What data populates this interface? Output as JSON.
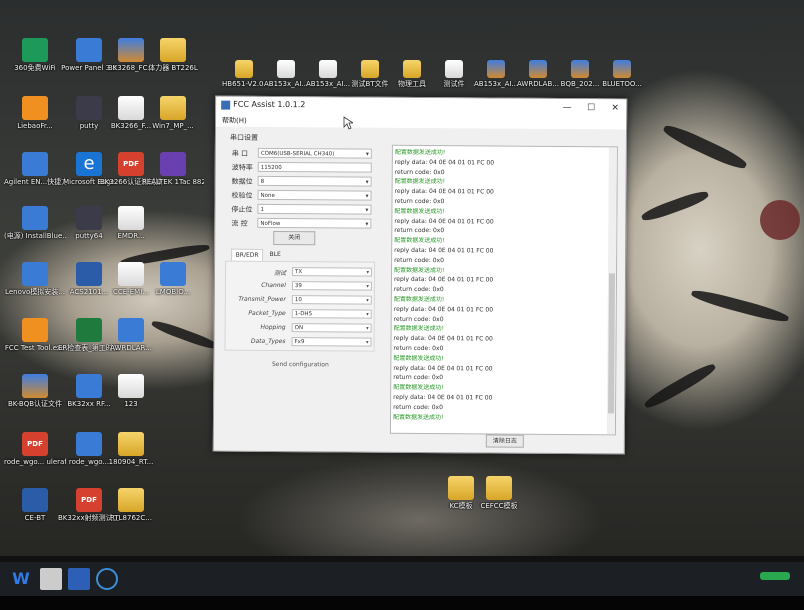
{
  "window": {
    "title": "FCC Assist 1.0.1.2",
    "menu_help": "帮助(H)",
    "minimize": "—",
    "maximize": "☐",
    "close": "✕"
  },
  "serial": {
    "title": "串口设置",
    "rows": [
      {
        "label": "串 口",
        "value": "COM6(USB-SERIAL CH340)"
      },
      {
        "label": "波特率",
        "value": "115200"
      },
      {
        "label": "数据位",
        "value": "8"
      },
      {
        "label": "校验位",
        "value": "None"
      },
      {
        "label": "停止位",
        "value": "1"
      },
      {
        "label": "流 控",
        "value": "NoFlow"
      }
    ],
    "open_button": "关闭"
  },
  "tabs": [
    "BR/EDR",
    "BLE"
  ],
  "config": [
    {
      "label": "测试",
      "value": "TX"
    },
    {
      "label": "Channel",
      "value": "39"
    },
    {
      "label": "Transmit_Power",
      "value": "10"
    },
    {
      "label": "Packet_Type",
      "value": "1-DH5"
    },
    {
      "label": "Hopping",
      "value": "ON"
    },
    {
      "label": "Data_Types",
      "value": "Fx9"
    }
  ],
  "send_button": "Send configuration",
  "log_lines": [
    {
      "text": "配置数据发送成功!",
      "ok": true
    },
    {
      "text": "reply data: 04 0E 04 01 01 FC 00",
      "ok": false
    },
    {
      "text": "return code: 0x0",
      "ok": false
    },
    {
      "text": "配置数据发送成功!",
      "ok": true
    },
    {
      "text": "reply data: 04 0E 04 01 01 FC 00",
      "ok": false
    },
    {
      "text": "return code: 0x0",
      "ok": false
    },
    {
      "text": "配置数据发送成功!",
      "ok": true
    },
    {
      "text": "reply data: 04 0E 04 01 01 FC 00",
      "ok": false
    },
    {
      "text": "return code: 0x0",
      "ok": false
    },
    {
      "text": "配置数据发送成功!",
      "ok": true
    },
    {
      "text": "reply data: 04 0E 04 01 01 FC 00",
      "ok": false
    },
    {
      "text": "return code: 0x0",
      "ok": false
    },
    {
      "text": "配置数据发送成功!",
      "ok": true
    },
    {
      "text": "reply data: 04 0E 04 01 01 FC 00",
      "ok": false
    },
    {
      "text": "return code: 0x0",
      "ok": false
    },
    {
      "text": "配置数据发送成功!",
      "ok": true
    },
    {
      "text": "reply data: 04 0E 04 01 01 FC 00",
      "ok": false
    },
    {
      "text": "return code: 0x0",
      "ok": false
    },
    {
      "text": "配置数据发送成功!",
      "ok": true
    },
    {
      "text": "reply data: 04 0E 04 01 01 FC 00",
      "ok": false
    },
    {
      "text": "return code: 0x0",
      "ok": false
    },
    {
      "text": "配置数据发送成功!",
      "ok": true
    },
    {
      "text": "reply data: 04 0E 04 01 01 FC 00",
      "ok": false
    },
    {
      "text": "return code: 0x0",
      "ok": false
    },
    {
      "text": "配置数据发送成功!",
      "ok": true
    },
    {
      "text": "reply data: 04 0E 04 01 01 FC 00",
      "ok": false
    },
    {
      "text": "return code: 0x0",
      "ok": false
    },
    {
      "text": "配置数据发送成功!",
      "ok": true
    }
  ],
  "clear_button": "清除日志",
  "desktop_icons": [
    {
      "label": "360免费WiFi",
      "icon": "wifi-icon"
    },
    {
      "label": "Power Panel 3.9",
      "icon": "app-icon"
    },
    {
      "label": "BK3268_FC...",
      "icon": "stack-icon"
    },
    {
      "label": "体力器 BT226L",
      "icon": "folder-icon"
    },
    {
      "label": "LiebaoFr...",
      "icon": "orange-icon"
    },
    {
      "label": "putty",
      "icon": "putty-icon"
    },
    {
      "label": "BK3266_F...",
      "icon": "file-icon"
    },
    {
      "label": "Win7_MP_...",
      "icon": "folder-icon"
    },
    {
      "label": "Agilent EN...快捷方式",
      "icon": "app-icon"
    },
    {
      "label": "Microsoft Edge",
      "icon": "edge-icon"
    },
    {
      "label": "BK3266认证测试操作...",
      "icon": "pdf-icon"
    },
    {
      "label": "REALTEK 1Tac 8821...",
      "icon": "purple-icon"
    },
    {
      "label": "(电源) InstallBlue...",
      "icon": "app-icon"
    },
    {
      "label": "putty64",
      "icon": "putty-icon"
    },
    {
      "label": "EMDR...",
      "icon": "file-icon"
    },
    {
      "label": "Lenovo模拟安装...",
      "icon": "app-icon"
    },
    {
      "label": "ACS2101...",
      "icon": "word-icon"
    },
    {
      "label": "CCE-EMI...",
      "icon": "file-icon"
    },
    {
      "label": "LMOBIO...",
      "icon": "app-icon"
    },
    {
      "label": "FCC Test Tool.exe",
      "icon": "orange-icon"
    },
    {
      "label": "ER检查表_第工时(20...",
      "icon": "excel-icon"
    },
    {
      "label": "AWRDLAR...",
      "icon": "app-icon"
    },
    {
      "label": "BK-BQB认证文件",
      "icon": "stack-icon"
    },
    {
      "label": "BK32xx RF...",
      "icon": "app-icon"
    },
    {
      "label": "123",
      "icon": "file-icon"
    },
    {
      "label": "rode_wgo... ulerafe...",
      "icon": "pdf-icon"
    },
    {
      "label": "rode_wgo...",
      "icon": "app-icon"
    },
    {
      "label": "180904_RT...",
      "icon": "folder-icon"
    },
    {
      "label": "CE-BT",
      "icon": "word-icon"
    },
    {
      "label": "BK32xx射频测试工具应...",
      "icon": "pdf-icon"
    },
    {
      "label": "RTL8762C...",
      "icon": "folder-icon"
    },
    {
      "label": "KC模板",
      "icon": "folder-icon"
    },
    {
      "label": "CEFCC模板",
      "icon": "folder-icon"
    }
  ],
  "top_icons": [
    {
      "label": "HB651-V2.0 测试工具",
      "icon": "folder-icon"
    },
    {
      "label": "AB153x_AI...",
      "icon": "file-icon"
    },
    {
      "label": "AB153x_AI...",
      "icon": "file-icon"
    },
    {
      "label": "测试BT文件",
      "icon": "folder-icon"
    },
    {
      "label": "物理工具",
      "icon": "folder-icon"
    },
    {
      "label": "测试件",
      "icon": "file-icon"
    },
    {
      "label": "AB153x_AI...",
      "icon": "stack-icon"
    },
    {
      "label": "AWRDLAB...",
      "icon": "stack-icon"
    },
    {
      "label": "BQB_202...",
      "icon": "stack-icon"
    },
    {
      "label": "BLUETOO...",
      "icon": "stack-icon"
    }
  ]
}
